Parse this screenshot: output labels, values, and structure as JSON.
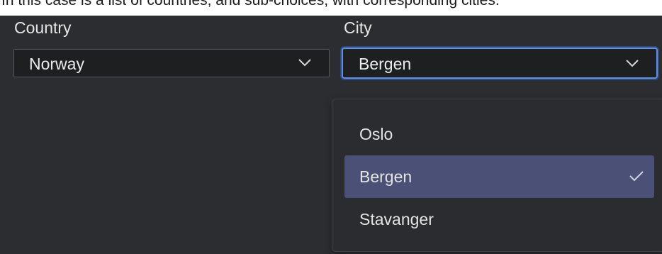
{
  "caption": "In this case is a list of countries, and sub-choices, with corresponding cities.",
  "country": {
    "label": "Country",
    "value": "Norway",
    "icon": "chevron-down-icon"
  },
  "city": {
    "label": "City",
    "value": "Bergen",
    "icon": "chevron-down-icon",
    "focused": true,
    "options": [
      {
        "label": "Oslo",
        "selected": false
      },
      {
        "label": "Bergen",
        "selected": true
      },
      {
        "label": "Stavanger",
        "selected": false
      }
    ],
    "selected_icon": "check-icon"
  },
  "colors": {
    "background": "#2b2d30",
    "field": "#1e1f21",
    "focus_ring": "#5f8fe6",
    "selected_option": "#4a5076"
  }
}
